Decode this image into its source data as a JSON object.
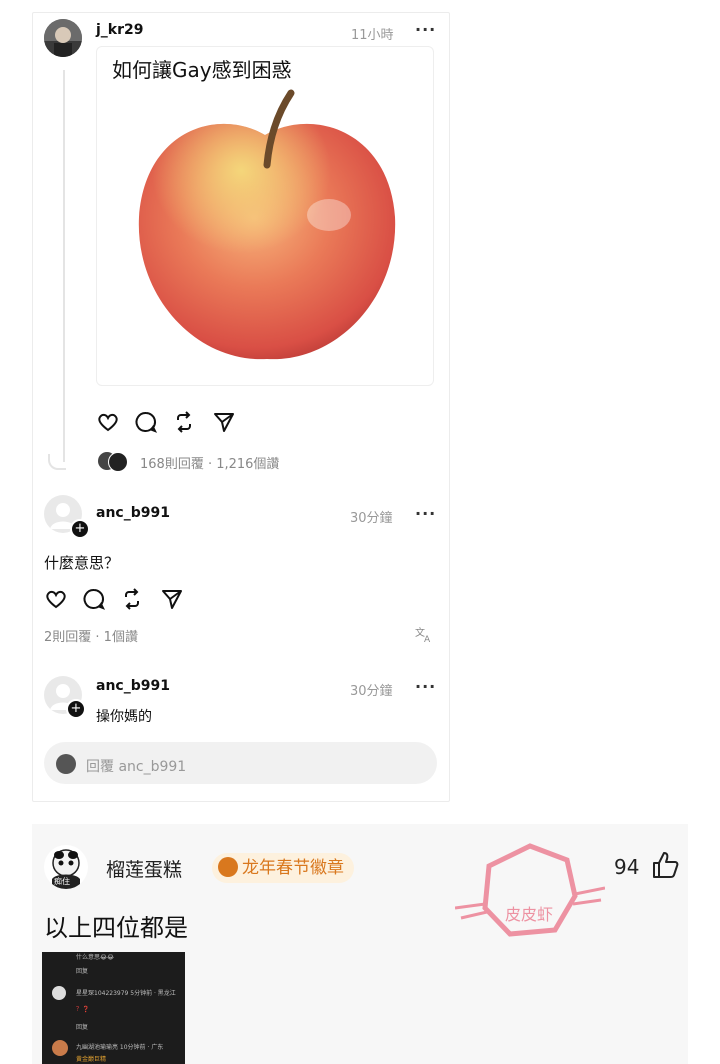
{
  "post": {
    "username": "j_kr29",
    "time": "11小時",
    "more": "···",
    "caption": "如何讓Gay感到困惑",
    "stats": "168則回覆 · 1,216個讚"
  },
  "comment1": {
    "username": "anc_b991",
    "time": "30分鐘",
    "more": "···",
    "text": "什麼意思？",
    "stats": "2則回覆 · 1個讚"
  },
  "comment2": {
    "username": "anc_b991",
    "time": "30分鐘",
    "more": "···",
    "text": "操你媽的"
  },
  "reply": {
    "placeholder": "回覆 anc_b991"
  },
  "bottom_comment": {
    "username": "榴莲蛋糕",
    "badge": "龙年春节徽章",
    "like_count": "94",
    "text": "以上四位都是",
    "avatar_caption": "痴住"
  },
  "inner_screenshot": {
    "line1": "什么意思😂😂",
    "line2": "回复",
    "line3": "星星琛10422397​9  5分钟前 · 黑龙江",
    "line4": "？❓",
    "line5": "回复",
    "line6": "九幽湖池瑜瑜亮  10分钟前 · 广东",
    "line7": "黄金巅巨精"
  },
  "watermark": {
    "text": "皮皮虾"
  },
  "colors": {
    "badge_text": "#d9781e",
    "badge_bg": "#fdf1de",
    "watermark": "#e8506a"
  },
  "icons": [
    "heart-icon",
    "comment-icon",
    "repost-icon",
    "share-icon",
    "translate-icon",
    "thumbs-up-icon"
  ]
}
